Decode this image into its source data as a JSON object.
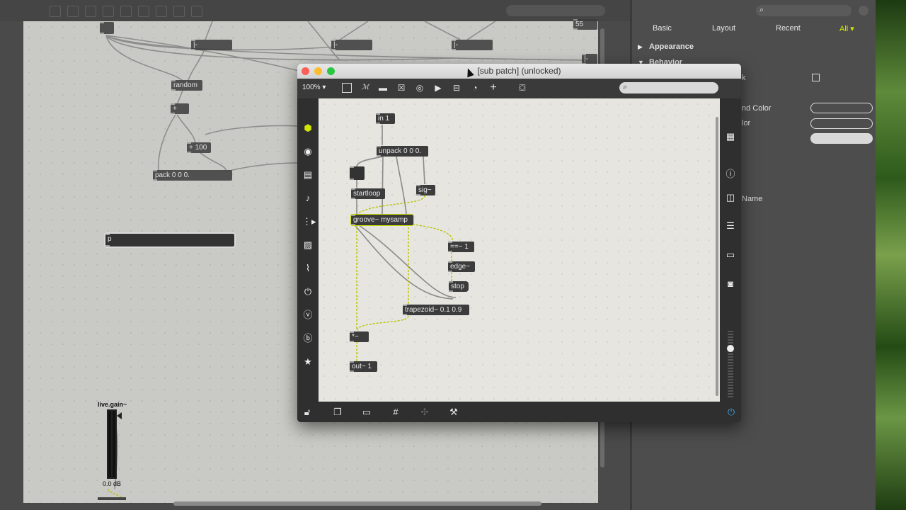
{
  "colors": {
    "accent_green": "#d4e600",
    "cable_yellow": "#b8c400",
    "power_blue": "#3aa2e0"
  },
  "main": {
    "objects": {
      "num_55": "55",
      "random": "random",
      "plus": "+",
      "plus_100": "+ 100",
      "pack": "pack 0 0 0.",
      "p_object": "p",
      "live_gain": "live.gain~",
      "gain_db": "0.0 dB",
      "msg1": "|-",
      "msg2": "|-",
      "msg3": "|-",
      "msg4": "|-"
    }
  },
  "inspector": {
    "tabs": {
      "basic": "Basic",
      "layout": "Layout",
      "recent": "Recent",
      "all": "All ▾"
    },
    "sections": {
      "appearance": "Appearance",
      "behavior": "Behavior"
    },
    "rows": {
      "row_k": "k",
      "bg_color": "nd Color",
      "color2": "lor",
      "name": "Name"
    }
  },
  "subpatch": {
    "title": "[sub patch] (unlocked)",
    "zoom": "100% ▾",
    "objects": {
      "in1": "in 1",
      "unpack": "unpack 0 0 0.",
      "startloop": "startloop",
      "sig": "sig~",
      "groove": "groove~ mysamp",
      "eq": "==~ 1",
      "edge": "edge~",
      "stop": "stop",
      "trapezoid": "trapezoid~ 0.1 0.9",
      "mul": "*~",
      "out1": "out~ 1"
    }
  },
  "icons": {
    "toolbar": [
      "presentation-icon",
      "comment-icon",
      "message-icon",
      "toggle-icon",
      "button-icon",
      "play-icon",
      "slider-icon",
      "dial-icon",
      "add-icon",
      "paint-bucket-icon"
    ],
    "left_palette": [
      "cube-icon",
      "record-icon",
      "keyboard-icon",
      "music-note-icon",
      "sequence-icon",
      "image-icon",
      "paperclip-icon",
      "plug-icon",
      "v-icon",
      "b-icon",
      "star-icon"
    ],
    "right_palette": [
      "grid-icon",
      "info-icon",
      "two-pane-icon",
      "list-icon",
      "book-icon",
      "camera-icon"
    ],
    "bottom_bar": [
      "lock-icon",
      "windows-icon",
      "presentation-mode-icon",
      "grid-snap-icon",
      "fix-icon",
      "wrench-icon",
      "power-icon"
    ]
  }
}
